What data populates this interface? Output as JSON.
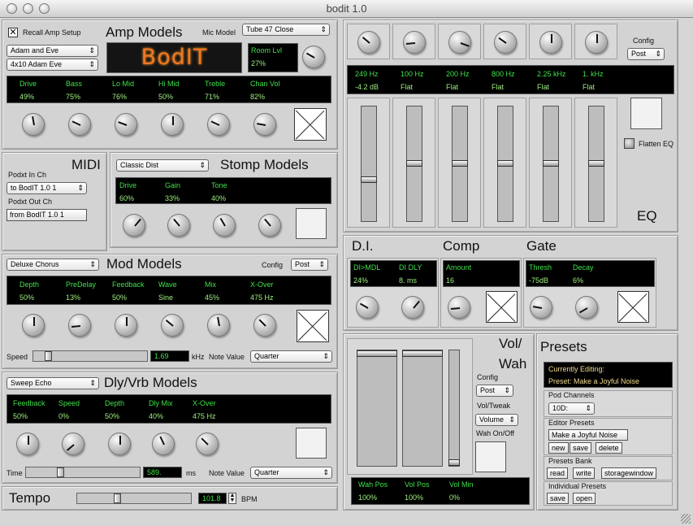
{
  "window": {
    "title": "bodit 1.0"
  },
  "amp": {
    "title": "Amp Models",
    "recall_label": "Recall Amp Setup",
    "mic_label": "Mic Model",
    "mic_value": "Tube 47 Close",
    "model1": "Adam and Eve",
    "model2": "4x10 Adam Eve",
    "logo": "BodIT",
    "room_label": "Room Lvl",
    "room_value": "27%",
    "params": [
      {
        "name": "Drive",
        "value": "49%"
      },
      {
        "name": "Bass",
        "value": "75%"
      },
      {
        "name": "Lo Mid",
        "value": "76%"
      },
      {
        "name": "Hi Mid",
        "value": "50%"
      },
      {
        "name": "Treble",
        "value": "71%"
      },
      {
        "name": "Chan Vol",
        "value": "82%"
      }
    ]
  },
  "midi": {
    "title": "MIDI",
    "in_label": "Podxt In Ch",
    "in_value": "to BodIT 1.0 1",
    "out_label": "Podxt Out Ch",
    "out_value": "from BodIT 1.0 1"
  },
  "stomp": {
    "title": "Stomp Models",
    "model": "Classic Dist",
    "params": [
      {
        "name": "Drive",
        "value": "60%"
      },
      {
        "name": "Gain",
        "value": "33%"
      },
      {
        "name": "Tone",
        "value": "40%"
      }
    ]
  },
  "mod": {
    "title": "Mod Models",
    "model": "Deluxe Chorus",
    "config_label": "Config",
    "config_value": "Post",
    "params": [
      {
        "name": "Depth",
        "value": "50%"
      },
      {
        "name": "PreDelay",
        "value": "13%"
      },
      {
        "name": "Feedback",
        "value": "50%"
      },
      {
        "name": "Wave",
        "value": "Sine"
      },
      {
        "name": "Mix",
        "value": "45%"
      },
      {
        "name": "X-Over",
        "value": "475 Hz"
      }
    ],
    "speed_label": "Speed",
    "speed_value": "1.69",
    "speed_unit": "kHz",
    "note_label": "Note Value",
    "note_value": "Quarter"
  },
  "dly": {
    "title": "Dly/Vrb Models",
    "model": "Sweep Echo",
    "params": [
      {
        "name": "Feedback",
        "value": "50%"
      },
      {
        "name": "Speed",
        "value": "0%"
      },
      {
        "name": "Depth",
        "value": "50%"
      },
      {
        "name": "Dly Mix",
        "value": "40%"
      },
      {
        "name": "X-Over",
        "value": "475 Hz"
      }
    ],
    "time_label": "Time",
    "time_value": "589.",
    "time_unit": "ms",
    "note_label": "Note Value",
    "note_value": "Quarter"
  },
  "tempo": {
    "title": "Tempo",
    "value": "101.8",
    "unit": "BPM"
  },
  "eq": {
    "title": "EQ",
    "config_label": "Config",
    "config_value": "Post",
    "flatten_label": "Flatten EQ",
    "bands": [
      {
        "freq": "249 Hz",
        "gain": "-4.2 dB"
      },
      {
        "freq": "100 Hz",
        "gain": "Flat"
      },
      {
        "freq": "200 Hz",
        "gain": "Flat"
      },
      {
        "freq": "800 Hz",
        "gain": "Flat"
      },
      {
        "freq": "2.25 kHz",
        "gain": "Flat"
      },
      {
        "freq": "1. kHz",
        "gain": "Flat"
      }
    ]
  },
  "di": {
    "title": "D.I.",
    "params": [
      {
        "name": "DI>MDL",
        "value": "24%"
      },
      {
        "name": "DI DLY",
        "value": "8. ms"
      }
    ]
  },
  "comp": {
    "title": "Comp",
    "params": [
      {
        "name": "Amount",
        "value": "16"
      }
    ]
  },
  "gate": {
    "title": "Gate",
    "params": [
      {
        "name": "Thresh",
        "value": "-75dB"
      },
      {
        "name": "Decay",
        "value": "6%"
      }
    ]
  },
  "volwah": {
    "title1": "Vol/",
    "title2": "Wah",
    "config_label": "Config",
    "config_value": "Post",
    "tweak_label": "Vol/Tweak",
    "tweak_value": "Volume",
    "wah_label": "Wah On/Off",
    "params": [
      {
        "name": "Wah Pos",
        "value": "100%"
      },
      {
        "name": "Vol Pos",
        "value": "100%"
      },
      {
        "name": "Vol Min",
        "value": "0%"
      }
    ]
  },
  "presets": {
    "title": "Presets",
    "editing_label": "Currently Editing:",
    "editing_value": "Preset: Make a Joyful Noise",
    "channels_label": "Pod Channels",
    "channel_value": "10D:",
    "editor_label": "Editor Presets",
    "editor_name": "Make a Joyful Noise",
    "new": "new",
    "save": "save",
    "delete": "delete",
    "bank_label": "Presets Bank",
    "read": "read",
    "write": "write",
    "storage": "storagewindow",
    "individual_label": "Individual Presets",
    "ind_save": "save",
    "ind_open": "open"
  }
}
